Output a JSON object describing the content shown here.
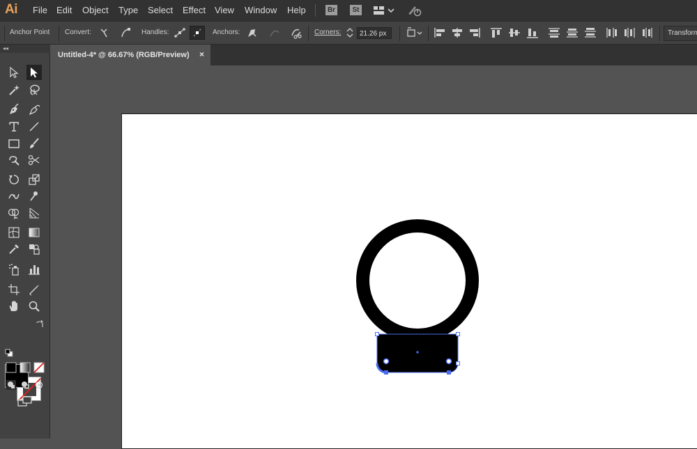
{
  "app": {
    "logo": "Ai"
  },
  "menu": {
    "items": [
      "File",
      "Edit",
      "Object",
      "Type",
      "Select",
      "Effect",
      "View",
      "Window",
      "Help"
    ],
    "bridge_label": "Br",
    "stock_label": "St"
  },
  "control_bar": {
    "anchor_point": "Anchor Point",
    "convert": "Convert:",
    "handles": "Handles:",
    "anchors": "Anchors:",
    "corners": "Corners:",
    "corners_value": "21.26 px",
    "transform": "Transform"
  },
  "document": {
    "tab_title": "Untitled-4* @ 66.67% (RGB/Preview)",
    "close_glyph": "×"
  },
  "colors": {
    "accent_selection": "#4a6cf2",
    "canvas": "#535353",
    "panel": "#424242",
    "menubar": "#323232",
    "logo": "#e8a25a"
  }
}
